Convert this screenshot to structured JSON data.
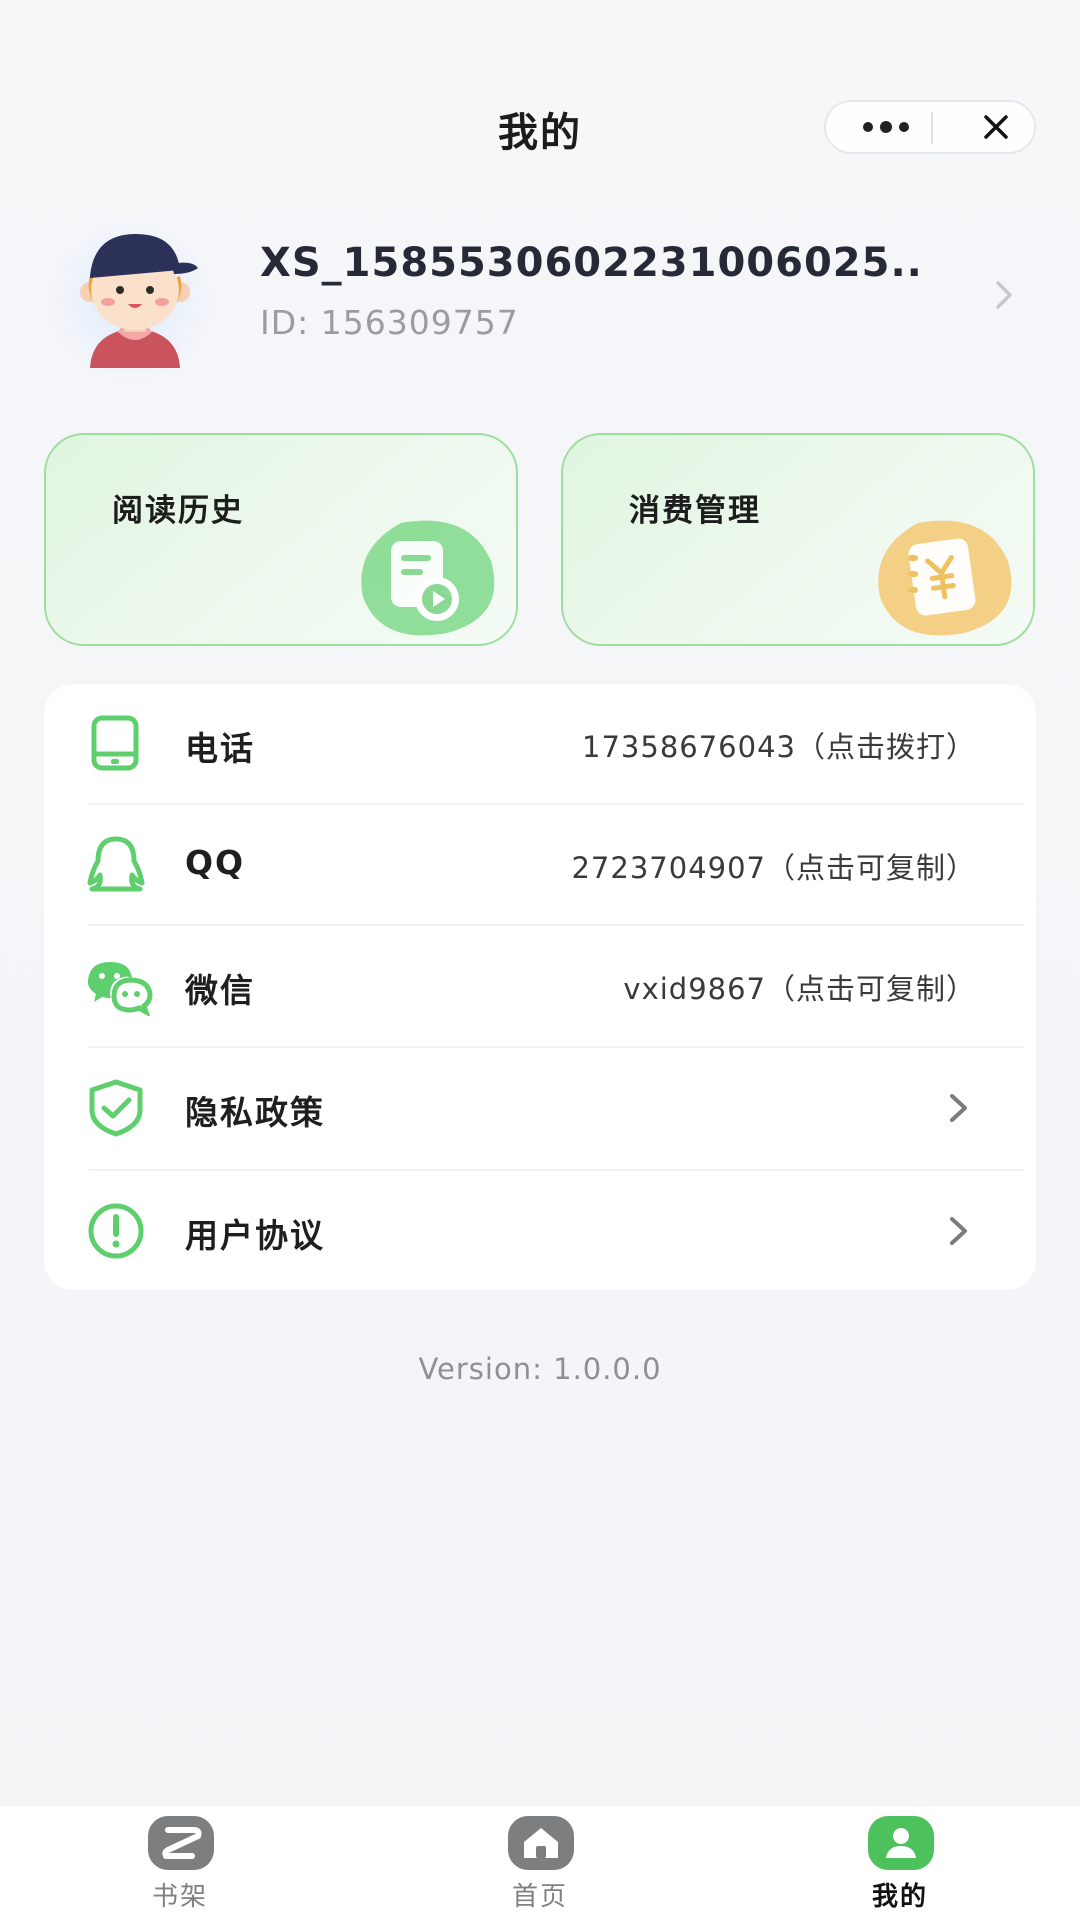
{
  "header": {
    "title": "我的"
  },
  "profile": {
    "username": "XS_1585530602231006025...",
    "id_text": "ID: 156309757"
  },
  "quick_cards": [
    {
      "label": "阅读历史",
      "icon": "reading-history-icon"
    },
    {
      "label": "消费管理",
      "icon": "wallet-yen-icon"
    }
  ],
  "info_list": [
    {
      "label": "电话",
      "value": "17358676043（点击拨打）",
      "icon": "phone-icon"
    },
    {
      "label": "QQ",
      "value": "2723704907（点击可复制）",
      "icon": "qq-icon"
    },
    {
      "label": "微信",
      "value": "vxid9867（点击可复制）",
      "icon": "wechat-icon"
    },
    {
      "label": "隐私政策",
      "value": "",
      "icon": "shield-check-icon"
    },
    {
      "label": "用户协议",
      "value": "",
      "icon": "exclamation-circle-icon"
    }
  ],
  "version": "Version: 1.0.0.0",
  "tabbar": {
    "tabs": [
      {
        "label": "书架",
        "icon": "bookshelf-icon"
      },
      {
        "label": "首页",
        "icon": "home-icon"
      },
      {
        "label": "我的",
        "icon": "user-icon"
      }
    ],
    "active_index": 2
  },
  "colors": {
    "accent": "#4cc15c",
    "card_border": "#9fdca0",
    "icon_green": "#5fcf6e",
    "gold": "#f3cb7a"
  }
}
